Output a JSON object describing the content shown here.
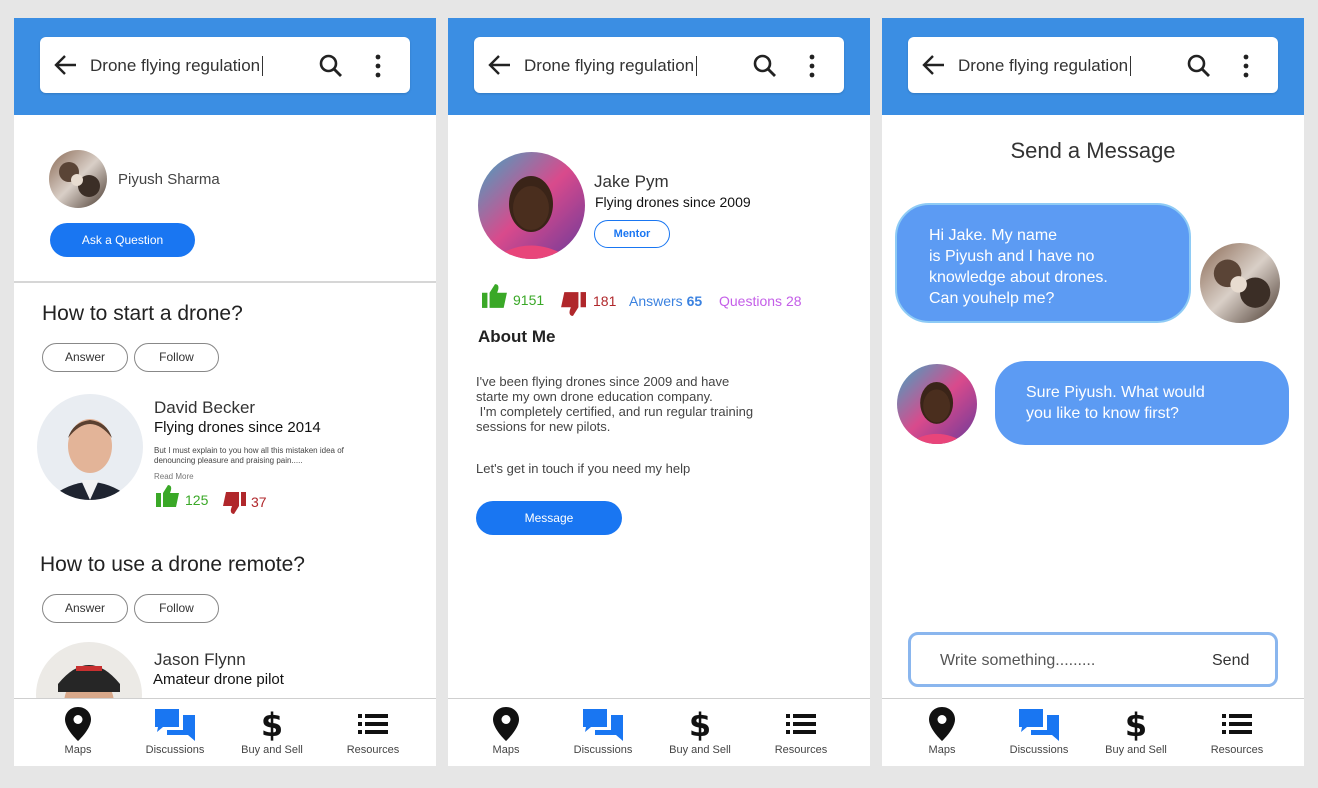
{
  "search": {
    "query": "Drone flying regulation"
  },
  "nav": {
    "maps": "Maps",
    "discussions": "Discussions",
    "buy_sell": "Buy and Sell",
    "resources": "Resources"
  },
  "screen1": {
    "user_name": "Piyush Sharma",
    "ask_button": "Ask a Question",
    "answer_label": "Answer",
    "follow_label": "Follow",
    "questions": [
      {
        "title": "How to start a drone?",
        "answerer": "David Becker",
        "answerer_subtitle": "Flying drones since 2014",
        "snippet": "But I must explain to you how all this mistaken idea of denouncing pleasure and praising pain.....",
        "read_more": "Read More",
        "likes": "125",
        "dislikes": "37"
      },
      {
        "title": "How to use a drone remote?",
        "answerer": "Jason Flynn",
        "answerer_subtitle": "Amateur drone pilot"
      }
    ]
  },
  "screen2": {
    "name": "Jake Pym",
    "subtitle": "Flying drones since 2009",
    "badge": "Mentor",
    "likes": "9151",
    "dislikes": "181",
    "answers_label": "Answers",
    "answers_count": "65",
    "questions_label": "Questions",
    "questions_count": "28",
    "about_title": "About Me",
    "about_lines": [
      "I've been flying drones since 2009 and have",
      "starte my own drone education company.",
      " I'm completely certified, and run regular training",
      "sessions for new pilots."
    ],
    "about_cta": "Let's get in touch if you need my help",
    "message_button": "Message"
  },
  "screen3": {
    "title": "Send a Message",
    "msg1_lines": [
      "Hi Jake. My name",
      "is Piyush and I have no",
      "knowledge about drones.",
      "Can youhelp me?"
    ],
    "msg2_lines": [
      "Sure Piyush. What would",
      "you like to know first?"
    ],
    "input_placeholder": "Write something.........",
    "send_label": "Send"
  },
  "colors": {
    "header": "#3b8ee3",
    "primary": "#1976f2",
    "like": "#3aa827",
    "dislike": "#b0272b",
    "answers": "#3b82e0",
    "questions": "#c45ee8",
    "bubble": "#5c9bf3"
  }
}
